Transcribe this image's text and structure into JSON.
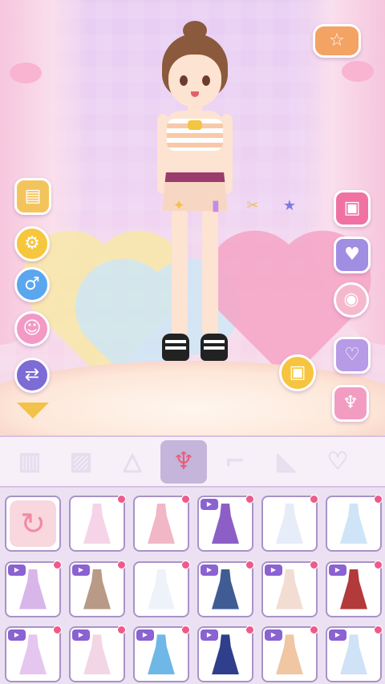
{
  "scene": {
    "camera_icon": "camera-icon",
    "palette": {
      "curtain": "#f7c4da",
      "stage": "#fde7d9",
      "heart_pink": "#f6a5c6",
      "heart_yellow": "#f8e9a8",
      "heart_blue": "#cfe7f6"
    }
  },
  "left_buttons": [
    {
      "name": "wardrobe-button",
      "icon": "wardrobe-icon",
      "color": "#f4c45c"
    },
    {
      "name": "settings-button",
      "icon": "gear-icon",
      "color": "#f6c63c"
    },
    {
      "name": "gender-button",
      "icon": "male-symbol-icon",
      "color": "#5aa6ef"
    },
    {
      "name": "characters-button",
      "icon": "characters-icon",
      "color": "#f29ac5"
    },
    {
      "name": "share-button",
      "icon": "share-icon",
      "color": "#7d6bd6"
    },
    {
      "name": "collapse-button",
      "icon": "triangle-down-icon",
      "color": "#f2c24a"
    }
  ],
  "right_buttons": [
    {
      "name": "shop-button",
      "icon": "cat-shop-icon",
      "color": "#f3a364"
    },
    {
      "name": "tv-button",
      "icon": "tv-icon",
      "color": "#f072a2"
    },
    {
      "name": "calendar-button",
      "icon": "calendar-icon",
      "color": "#a08ee3"
    },
    {
      "name": "sticker-button",
      "icon": "sticker-icon",
      "color": "#f5b8cc"
    },
    {
      "name": "frame-button",
      "icon": "heart-frame-icon",
      "color": "#b79be6"
    },
    {
      "name": "outfit-button",
      "icon": "dress-icon",
      "color": "#f39cc1"
    }
  ],
  "tools": [
    {
      "name": "makeup-tool",
      "icon": "makeup-icon",
      "color": "#f4c14e"
    },
    {
      "name": "nail-tool",
      "icon": "nail-polish-icon",
      "color": "#c68be8"
    },
    {
      "name": "scissors-tool",
      "icon": "scissors-icon",
      "color": "#f0c24f"
    },
    {
      "name": "star-tool",
      "icon": "star-icon",
      "color": "#7c7ce0"
    }
  ],
  "categories": [
    {
      "name": "jacket",
      "icon": "jacket-icon",
      "active": false
    },
    {
      "name": "shorts",
      "icon": "shorts-icon",
      "active": false
    },
    {
      "name": "skirt",
      "icon": "skirt-icon",
      "active": false
    },
    {
      "name": "dress",
      "icon": "dress-icon",
      "active": true
    },
    {
      "name": "socks",
      "icon": "sock-icon",
      "active": false
    },
    {
      "name": "shoes",
      "icon": "shoe-icon",
      "active": false
    },
    {
      "name": "glasses",
      "icon": "heart-glasses-icon",
      "active": false
    }
  ],
  "items": [
    {
      "kind": "reset",
      "icon": "reset-icon"
    },
    {
      "color": "#f5d4e8",
      "video": false,
      "dot": true
    },
    {
      "color": "#f2b7c6",
      "video": false,
      "dot": true
    },
    {
      "color": "#8d5fc6",
      "video": true,
      "dot": true
    },
    {
      "color": "#e6ecf8",
      "video": false,
      "dot": true
    },
    {
      "color": "#cfe5f7",
      "video": false,
      "dot": true
    },
    {
      "color": "#d9b6e9",
      "video": true,
      "dot": true
    },
    {
      "color": "#b89a86",
      "video": true,
      "dot": true
    },
    {
      "color": "#eef3fa",
      "video": false,
      "dot": true
    },
    {
      "color": "#3f5d94",
      "video": true,
      "dot": true
    },
    {
      "color": "#f3ddd2",
      "video": true,
      "dot": true
    },
    {
      "color": "#b23a3a",
      "video": true,
      "dot": true
    },
    {
      "color": "#e4c6ef",
      "video": true,
      "dot": true
    },
    {
      "color": "#f2d6e6",
      "video": true,
      "dot": true
    },
    {
      "color": "#6fb7e6",
      "video": true,
      "dot": true
    },
    {
      "color": "#2f3f8c",
      "video": true,
      "dot": true
    },
    {
      "color": "#f0c6a3",
      "video": true,
      "dot": true
    },
    {
      "color": "#cfe2f6",
      "video": true,
      "dot": true
    }
  ]
}
